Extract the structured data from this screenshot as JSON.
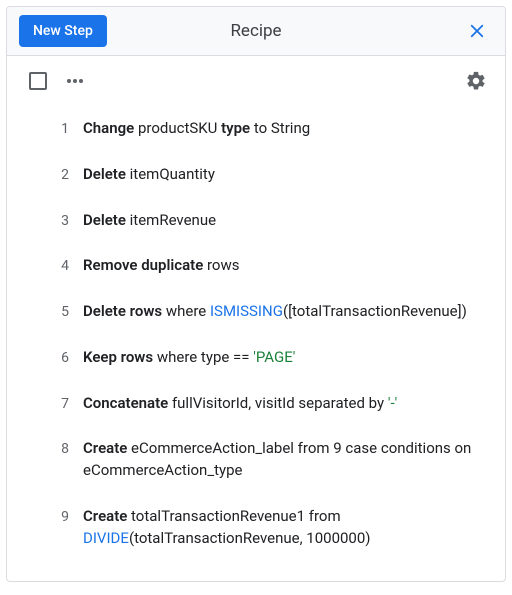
{
  "header": {
    "new_step_label": "New Step",
    "title": "Recipe"
  },
  "steps": [
    {
      "n": 1,
      "parts": [
        {
          "t": "Change ",
          "cls": "b"
        },
        {
          "t": "productSKU "
        },
        {
          "t": "type ",
          "cls": "b"
        },
        {
          "t": "to String"
        }
      ]
    },
    {
      "n": 2,
      "parts": [
        {
          "t": "Delete ",
          "cls": "b"
        },
        {
          "t": "itemQuantity"
        }
      ]
    },
    {
      "n": 3,
      "parts": [
        {
          "t": "Delete ",
          "cls": "b"
        },
        {
          "t": "itemRevenue"
        }
      ]
    },
    {
      "n": 4,
      "parts": [
        {
          "t": "Remove duplicate ",
          "cls": "b"
        },
        {
          "t": "rows"
        }
      ]
    },
    {
      "n": 5,
      "parts": [
        {
          "t": "Delete rows ",
          "cls": "b"
        },
        {
          "t": "where "
        },
        {
          "t": "ISMISSING",
          "cls": "fn"
        },
        {
          "t": "([totalTransactionRevenue])"
        }
      ]
    },
    {
      "n": 6,
      "parts": [
        {
          "t": "Keep rows ",
          "cls": "b"
        },
        {
          "t": "where type == "
        },
        {
          "t": "'PAGE'",
          "cls": "str"
        }
      ]
    },
    {
      "n": 7,
      "parts": [
        {
          "t": "Concatenate ",
          "cls": "b"
        },
        {
          "t": "fullVisitorId, visitId separated by "
        },
        {
          "t": "'-'",
          "cls": "str"
        }
      ]
    },
    {
      "n": 8,
      "parts": [
        {
          "t": "Create ",
          "cls": "b"
        },
        {
          "t": "eCommerceAction_label from 9 case conditions on eCommerceAction_type"
        }
      ]
    },
    {
      "n": 9,
      "parts": [
        {
          "t": "Create ",
          "cls": "b"
        },
        {
          "t": "totalTransactionRevenue1 from "
        },
        {
          "t": "DIVIDE",
          "cls": "fn"
        },
        {
          "t": "(totalTransactionRevenue, 1000000)"
        }
      ]
    }
  ]
}
